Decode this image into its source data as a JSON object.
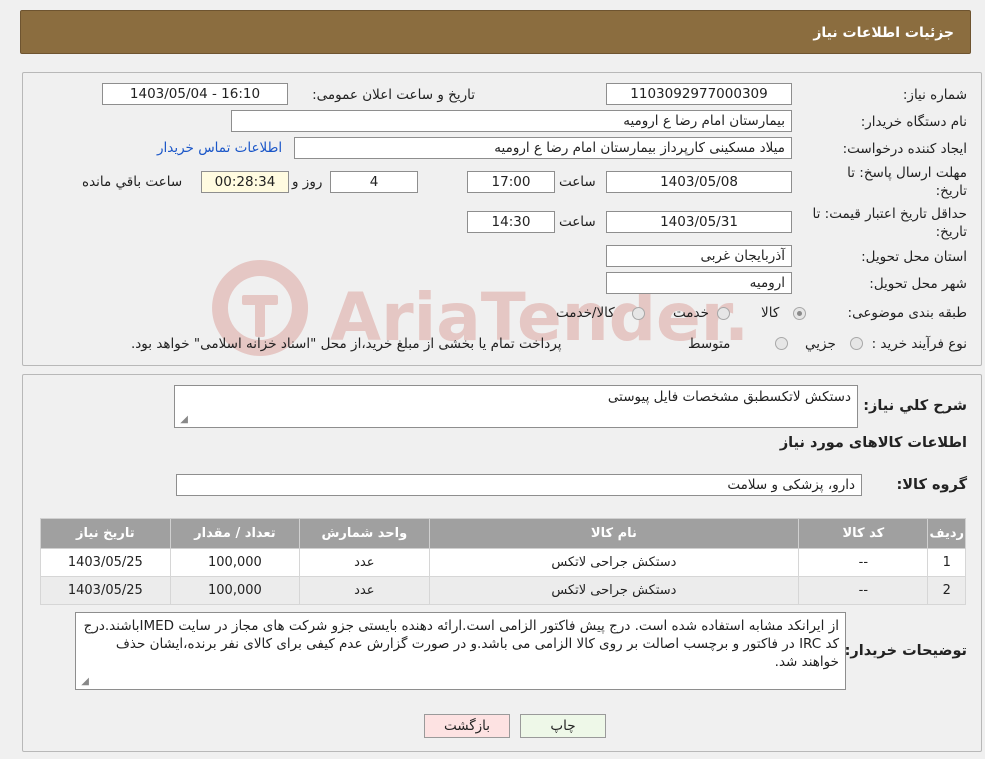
{
  "header": {
    "title": "جزئیات اطلاعات نیاز"
  },
  "form": {
    "need_number_label": "شماره نیاز:",
    "need_number": "1103092977000309",
    "announce_label": "تاریخ و ساعت اعلان عمومی:",
    "announce_value": "1403/05/04 - 16:10",
    "buyer_org_label": "نام دستگاه خریدار:",
    "buyer_org": "بیمارستان امام رضا  ع  ارومیه",
    "creator_label": "ایجاد کننده درخواست:",
    "creator": "میلاد مسکینی کارپرداز بیمارستان امام رضا  ع  ارومیه",
    "contact_link": "اطلاعات تماس خریدار",
    "deadline_label_1": "مهلت ارسال پاسخ: تا",
    "deadline_label_2": "تاریخ:",
    "deadline_date": "1403/05/08",
    "time_label": "ساعت",
    "deadline_time": "17:00",
    "days_value": "4",
    "days_label": "روز و",
    "remaining_time": "00:28:34",
    "remaining_label": "ساعت باقي مانده",
    "price_valid_label_1": "حداقل تاریخ اعتبار قیمت: تا",
    "price_valid_label_2": "تاریخ:",
    "price_valid_date": "1403/05/31",
    "price_valid_time": "14:30",
    "province_label": "استان محل تحویل:",
    "province": "آذربایجان غربی",
    "city_label": "شهر محل تحویل:",
    "city": "ارومیه",
    "category_label": "طبقه بندی موضوعی:",
    "category_options": [
      "کالا",
      "خدمت",
      "کالا/خدمت"
    ],
    "process_label": "نوع فرآیند خرید :",
    "process_options": [
      "جزیي",
      "متوسط"
    ],
    "process_note": "پرداخت تمام یا بخشی از مبلغ خرید،از محل \"اسناد خزانه اسلامی\" خواهد بود."
  },
  "summary": {
    "desc_label": "شرح کلي نیاز:",
    "desc_value": "دستکش لاتکسطبق مشخصات فایل پیوستی",
    "goods_info_title": "اطلاعات کالاهای مورد نیاز",
    "group_label": "گروه کالا:",
    "group_value": "دارو، پزشکی و سلامت"
  },
  "table": {
    "headers": [
      "ردیف",
      "کد کالا",
      "نام کالا",
      "واحد شمارش",
      "تعداد / مقدار",
      "تاریخ نیاز"
    ],
    "rows": [
      [
        "1",
        "--",
        "دستکش جراحی لاتکس",
        "عدد",
        "100,000",
        "1403/05/25"
      ],
      [
        "2",
        "--",
        "دستکش جراحی لاتکس",
        "عدد",
        "100,000",
        "1403/05/25"
      ]
    ]
  },
  "notes": {
    "label": "توضیحات خریدار:",
    "text": "از ایرانکد مشابه استفاده شده است. درج پیش فاکتور الزامی است.ارائه دهنده بایستی جزو شرکت های مجاز در سایت IMEDباشند.درج کد IRC در فاکتور و برچسب اصالت بر روی کالا الزامی می باشد.و در صورت گزارش عدم کیفی برای کالای نفر برنده،ایشان حذف خواهند شد."
  },
  "buttons": {
    "print": "چاپ",
    "back": "بازگشت"
  },
  "watermark": {
    "text": "AriaTender.neT"
  },
  "colors": {
    "header_bg": "#8b6d3f",
    "link": "#1a56c8",
    "table_header": "#a0a0a0",
    "print_btn": "#eef8e8",
    "back_btn": "#fde2e2"
  }
}
